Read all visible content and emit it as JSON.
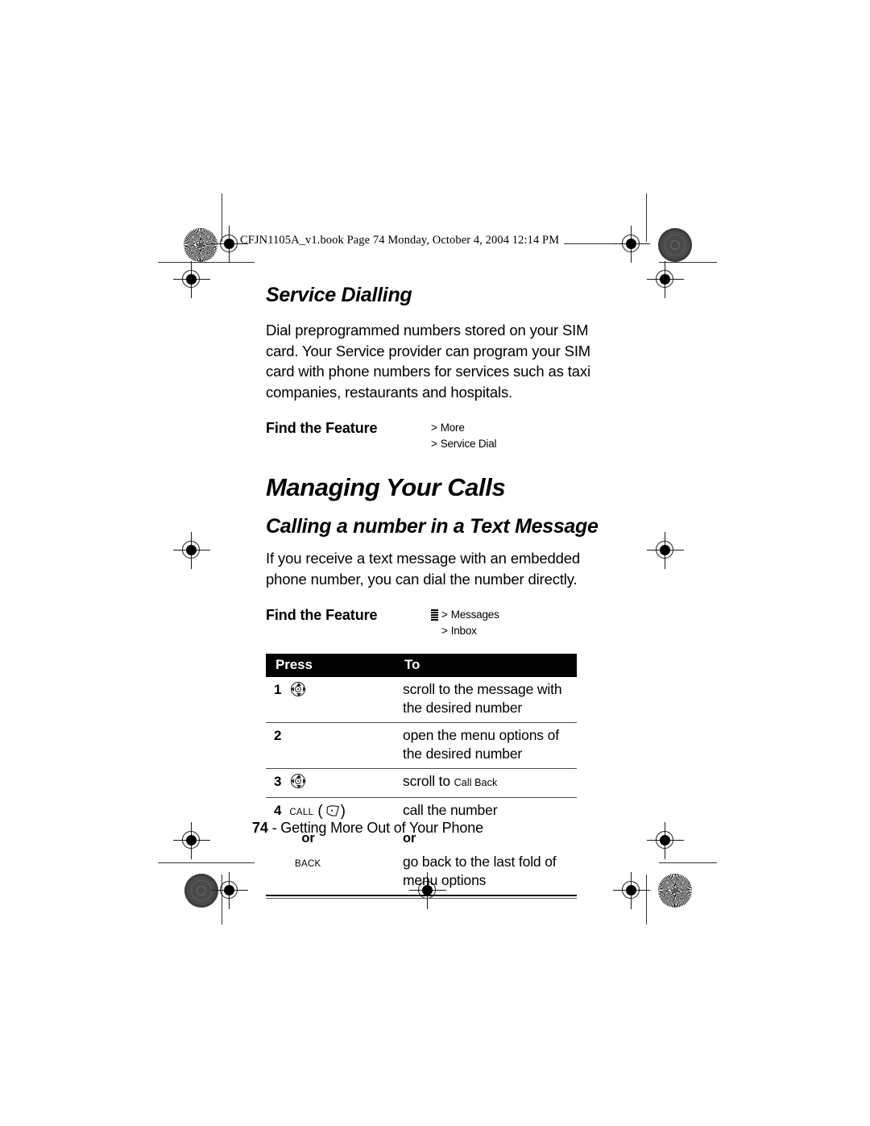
{
  "page_header": "CFJN1105A_v1.book  Page 74  Monday, October 4, 2004  12:14 PM",
  "section": {
    "title": "Service Dialling",
    "body": "Dial preprogrammed numbers stored on your SIM card. Your Service provider can program your SIM card with phone numbers for services such as taxi companies, restaurants and hospitals.",
    "find_feature": {
      "label": "Find the Feature",
      "path": [
        "More",
        "Service Dial"
      ],
      "chevron": ">"
    }
  },
  "chapter": {
    "title": "Managing Your Calls"
  },
  "subsection": {
    "title": "Calling a number in a Text Message",
    "body": "If you receive a text message with an embedded phone number, you can dial the number directly.",
    "find_feature": {
      "label": "Find the Feature",
      "icon": "menu-list-icon",
      "path": [
        "Messages",
        "Inbox"
      ],
      "chevron": ">"
    }
  },
  "steps_table": {
    "headers": {
      "press": "Press",
      "to": "To"
    },
    "rows": [
      {
        "num": "1",
        "key_icon": "nav-key-icon",
        "key_label": "",
        "action": "scroll to the message with the desired number"
      },
      {
        "num": "2",
        "key_icon": "",
        "key_label": "",
        "action": "open the menu options of the desired number"
      },
      {
        "num": "3",
        "key_icon": "nav-key-icon",
        "key_label": "",
        "action_prefix": "scroll to ",
        "action_term": "Call Back"
      },
      {
        "num": "4",
        "key_icon": "call-key-icon",
        "key_label": "CALL",
        "action": "call the number"
      }
    ],
    "or_row": {
      "press": "or",
      "to": "or"
    },
    "alt_row": {
      "key_label": "BACK",
      "action": "go back to the last fold of menu options"
    }
  },
  "footer": {
    "page_number": "74",
    "separator": " - ",
    "chapter_name": "Getting More Out of Your Phone"
  },
  "colors": {
    "text": "#000000",
    "header_bar": "#000000",
    "header_bar_text": "#ffffff",
    "rule": "#4a4a4a",
    "registration_dark": "#4a4a4a"
  }
}
